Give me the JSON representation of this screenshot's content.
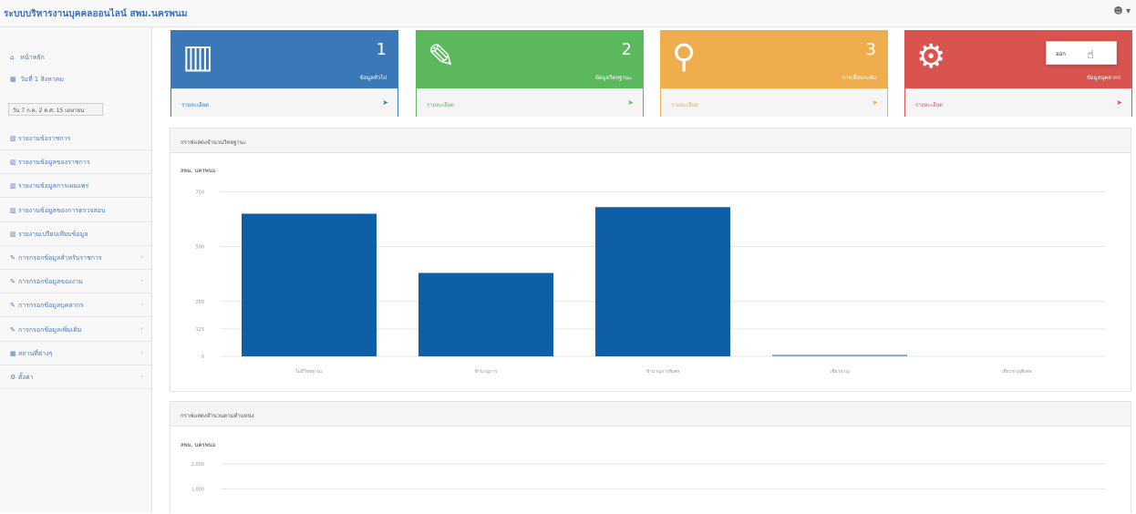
{
  "app": {
    "title": "ระบบบริหารงานบุคคลออนไลน์ สพม.นครพนม",
    "user_icon": "user-icon",
    "user_caret": "▾",
    "user_menu_item": "ออก"
  },
  "sidebar": {
    "home": "หน้าหลัก",
    "today": "วันที่ 1 สิงหาคม",
    "date_value": "วัน 7 ก.ค. 2 ค.ศ. 15 เมษายน",
    "items": [
      {
        "label": "รายงานข้อราชการ",
        "icon": "bar-chart-icon"
      },
      {
        "label": "รายงานข้อมูลของราชการ",
        "icon": "bar-chart-icon"
      },
      {
        "label": "รายงานข้อมูลการเผยแพร่",
        "icon": "bar-chart-icon"
      },
      {
        "label": "รายงานข้อมูลของการตรวจสอบ",
        "icon": "bar-chart-icon"
      },
      {
        "label": "รายงานเปรียบเทียบข้อมูล",
        "icon": "bar-chart-icon"
      },
      {
        "label": "การกรอกข้อมูลสำหรับราชการ",
        "icon": "edit-icon"
      },
      {
        "label": "การกรอกข้อมูลของงาน",
        "icon": "edit-icon"
      },
      {
        "label": "การกรอกข้อมูลบุคลากร",
        "icon": "edit-icon"
      },
      {
        "label": "การกรอกข้อมูลเพิ่มเติม",
        "icon": "edit-icon"
      },
      {
        "label": "สถานที่ต่างๆ",
        "icon": "building-icon"
      },
      {
        "label": "ตั้งค่า",
        "icon": "gear-icon"
      }
    ]
  },
  "cards": [
    {
      "number": "1",
      "caption": "ข้อมูลทั่วไป",
      "footer": "รายละเอียด",
      "color": "#3a78b8",
      "icon": "bar-chart-icon"
    },
    {
      "number": "2",
      "caption": "ข้อมูลวิทยฐานะ",
      "footer": "รายละเอียด",
      "color": "#5cb85c",
      "icon": "edit-icon"
    },
    {
      "number": "3",
      "caption": "การเลื่อนระดับ",
      "footer": "รายละเอียด",
      "color": "#f0ad4e",
      "icon": "map-marker-icon"
    },
    {
      "number": "",
      "caption": "ข้อมูลบุคลากร",
      "footer": "รายละเอียด",
      "color": "#d9534f",
      "icon": "gear-icon"
    }
  ],
  "panels": [
    {
      "title": "กราฟแสดงจำนวนวิทยฐานะ",
      "subtitle": "สพม. นครพนม"
    },
    {
      "title": "กราฟแสดงจำนวนตามตำแหน่ง",
      "subtitle": "สพม. นครพนม"
    }
  ],
  "chart_data": [
    {
      "type": "bar",
      "categories": [
        "ไม่มีวิทยฐานะ",
        "ชำนาญการ",
        "ชำนาญการพิเศษ",
        "เชี่ยวชาญ",
        "เชี่ยวชาญพิเศษ"
      ],
      "values": [
        650,
        380,
        680,
        8,
        0
      ],
      "yticks": [
        "750",
        "500",
        "250",
        "125",
        "0"
      ],
      "ylim": [
        0,
        760
      ],
      "color": "#0e5fa5",
      "grid": true
    },
    {
      "type": "bar",
      "categories": [],
      "values": [],
      "yticks": [
        "2,000",
        "1,000"
      ],
      "ylim": [
        0,
        2400
      ],
      "color": "#0e5fa5",
      "grid": true
    }
  ]
}
